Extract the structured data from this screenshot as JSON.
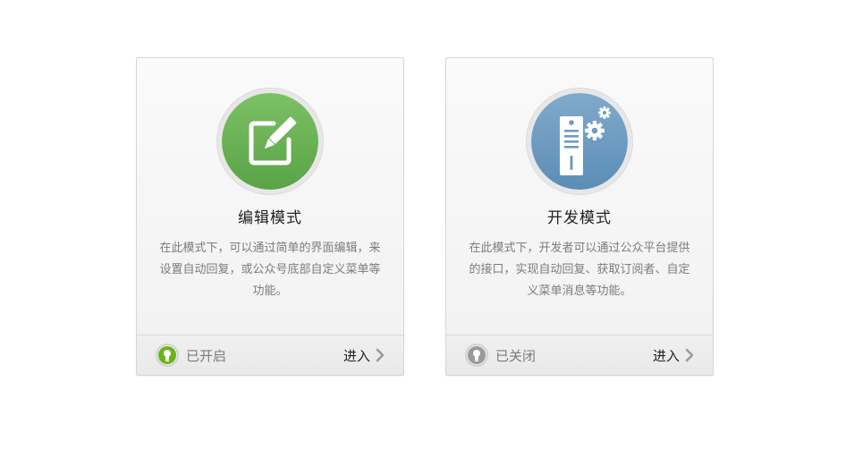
{
  "cards": [
    {
      "title": "编辑模式",
      "description": "在此模式下，可以通过简单的界面编辑，来设置自动回复，或公众号底部自定义菜单等功能。",
      "icon": "edit-icon",
      "icon_color": "#6ab04c",
      "status_label": "已开启",
      "status_color": "#6db31e",
      "enter_label": "进入"
    },
    {
      "title": "开发模式",
      "description": "在此模式下，开发者可以通过公众平台提供的接口，实现自动回复、获取订阅者、自定义菜单消息等功能。",
      "icon": "developer-settings-icon",
      "icon_color": "#6d9cc1",
      "status_label": "已关闭",
      "status_color": "#9a9a9a",
      "enter_label": "进入"
    }
  ]
}
